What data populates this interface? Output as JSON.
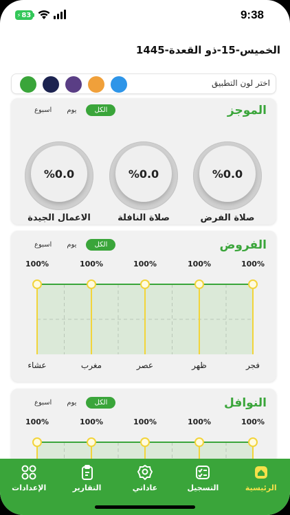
{
  "status_bar": {
    "battery": "83",
    "time": "9:38"
  },
  "date": "الخميس-15-ذو القعدة-1445",
  "color_picker": {
    "label": "اختر لون التطبيق",
    "colors": [
      "#3aa53a",
      "#1c2350",
      "#5a3e85",
      "#f0a03a",
      "#2e95e8"
    ]
  },
  "summary": {
    "title": "الموجز",
    "tabs": [
      "الكل",
      "يوم",
      "اسبوع"
    ],
    "gauges": [
      {
        "label": "صلاة الفرض",
        "value": "%0.0"
      },
      {
        "label": "صلاة النافلة",
        "value": "%0.0"
      },
      {
        "label": "الاعمال الجيدة",
        "value": "%0.0"
      }
    ]
  },
  "fard": {
    "title": "الفروض",
    "tabs": [
      "الكل",
      "يوم",
      "اسبوع"
    ]
  },
  "nawafil": {
    "title": "النوافل",
    "tabs": [
      "الكل",
      "يوم",
      "اسبوع"
    ]
  },
  "chart_data": [
    {
      "type": "line",
      "title": "الفروض",
      "categories": [
        "فجر",
        "ظهر",
        "عصر",
        "مغرب",
        "عشاء"
      ],
      "values": [
        100,
        100,
        100,
        100,
        100
      ],
      "value_labels": [
        "100%",
        "100%",
        "100%",
        "100%",
        "100%"
      ],
      "ylim": [
        0,
        100
      ],
      "grid": true
    },
    {
      "type": "line",
      "title": "النوافل",
      "categories": [],
      "values": [
        100,
        100,
        100,
        100,
        100
      ],
      "value_labels": [
        "100%",
        "100%",
        "100%",
        "100%",
        "100%"
      ],
      "ylim": [
        0,
        100
      ],
      "grid": true
    }
  ],
  "nav": [
    {
      "label": "الإعدادات",
      "icon": "grid-icon"
    },
    {
      "label": "التقارير",
      "icon": "clipboard-icon"
    },
    {
      "label": "عاداتي",
      "icon": "badge-icon"
    },
    {
      "label": "التسجيل",
      "icon": "checklist-icon"
    },
    {
      "label": "الرئيسية",
      "icon": "home-icon",
      "active": true
    }
  ]
}
